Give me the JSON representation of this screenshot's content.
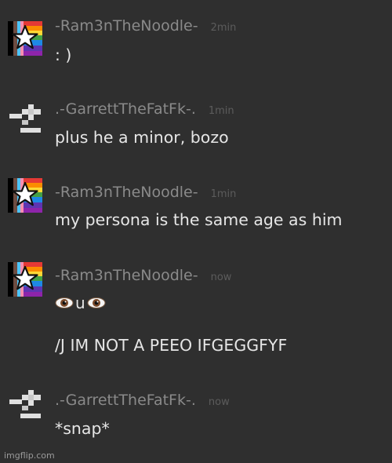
{
  "messages": [
    {
      "user": "-Ram3nTheNoodle-",
      "time": "2min",
      "avatar": "rainbow-star",
      "lines": [
        ": )"
      ]
    },
    {
      "user": ".-GarrettTheFatFk-.",
      "time": "1min",
      "avatar": "pixel-sprite",
      "lines": [
        "plus he a minor, bozo"
      ]
    },
    {
      "user": "-Ram3nTheNoodle-",
      "time": "1min",
      "avatar": "rainbow-star",
      "lines": [
        "my persona is the same age as him"
      ]
    },
    {
      "user": "-Ram3nTheNoodle-",
      "time": "now",
      "avatar": "rainbow-star",
      "lines": [
        "u",
        "/J IM NOT A PEEO IFGEGGFYF"
      ]
    },
    {
      "user": ".-GarrettTheFatFk-.",
      "time": "now",
      "avatar": "pixel-sprite",
      "lines": [
        "*snap*"
      ]
    }
  ],
  "watermark": "imgflip.com"
}
